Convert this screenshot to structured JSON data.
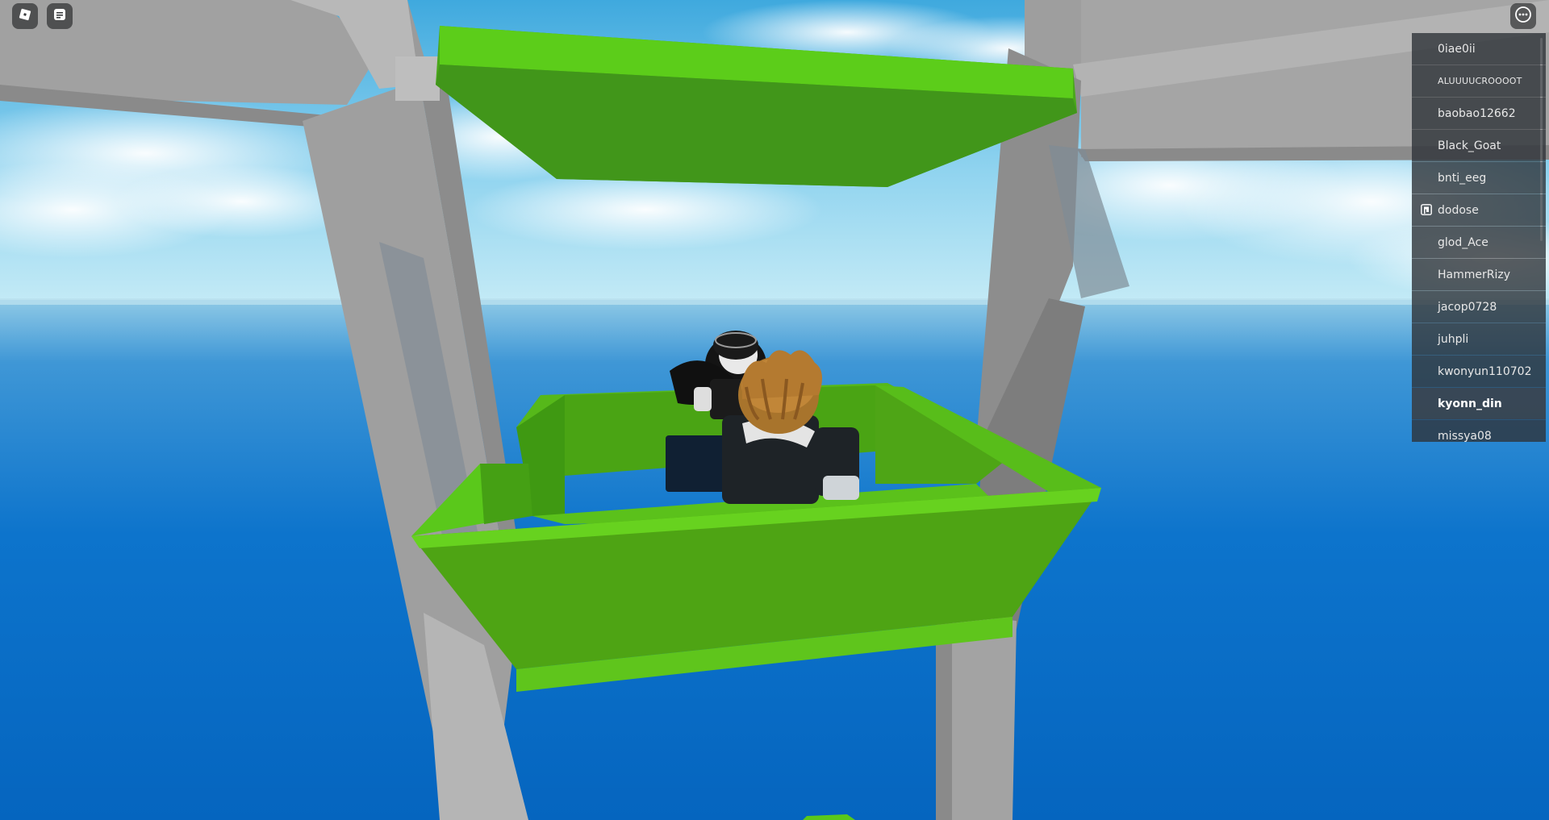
{
  "hud": {
    "roblox_menu_icon": "roblox-logo-icon",
    "chat_icon": "chat-icon",
    "more_icon": "more-options-icon"
  },
  "player_list": {
    "players": [
      {
        "name": "0iae0ii",
        "badge": ""
      },
      {
        "name": "ALUUUUCROOOOT",
        "badge": ""
      },
      {
        "name": "baobao12662",
        "badge": ""
      },
      {
        "name": "Black_Goat",
        "badge": ""
      },
      {
        "name": "bnti_eeg",
        "badge": ""
      },
      {
        "name": "dodose",
        "badge": "premium-icon"
      },
      {
        "name": "glod_Ace",
        "badge": ""
      },
      {
        "name": "HammerRizy",
        "badge": ""
      },
      {
        "name": "jacop0728",
        "badge": ""
      },
      {
        "name": "juhpli",
        "badge": ""
      },
      {
        "name": "kwonyun110702",
        "badge": ""
      },
      {
        "name": "kyonn_din",
        "badge": "",
        "is_local": true
      },
      {
        "name": "missya08",
        "badge": ""
      }
    ]
  },
  "colors": {
    "platform_green": "#4fbe13",
    "beam_gray": "#a3a3a3",
    "ocean_blue": "#0a72cc",
    "sky_blue": "#5db8e6"
  }
}
